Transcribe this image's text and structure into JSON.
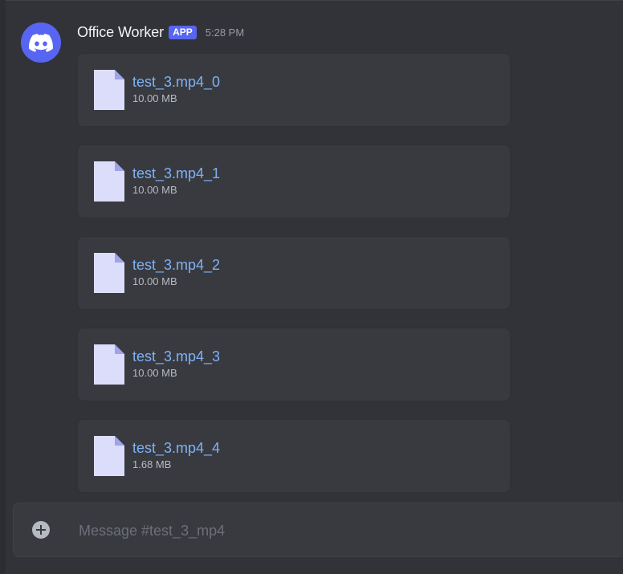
{
  "message": {
    "author": "Office Worker",
    "badge": "APP",
    "timestamp": "5:28 PM",
    "avatar_icon": "discord-logo-icon",
    "attachments": [
      {
        "name": "test_3.mp4_0",
        "size": "10.00 MB"
      },
      {
        "name": "test_3.mp4_1",
        "size": "10.00 MB"
      },
      {
        "name": "test_3.mp4_2",
        "size": "10.00 MB"
      },
      {
        "name": "test_3.mp4_3",
        "size": "10.00 MB"
      },
      {
        "name": "test_3.mp4_4",
        "size": "1.68 MB"
      }
    ]
  },
  "composer": {
    "placeholder": "Message #test_3_mp4",
    "add_icon": "plus-circle-icon"
  },
  "colors": {
    "background": "#313338",
    "accent": "#5865f2",
    "link": "#7fb1f5",
    "card": "#383a40"
  }
}
